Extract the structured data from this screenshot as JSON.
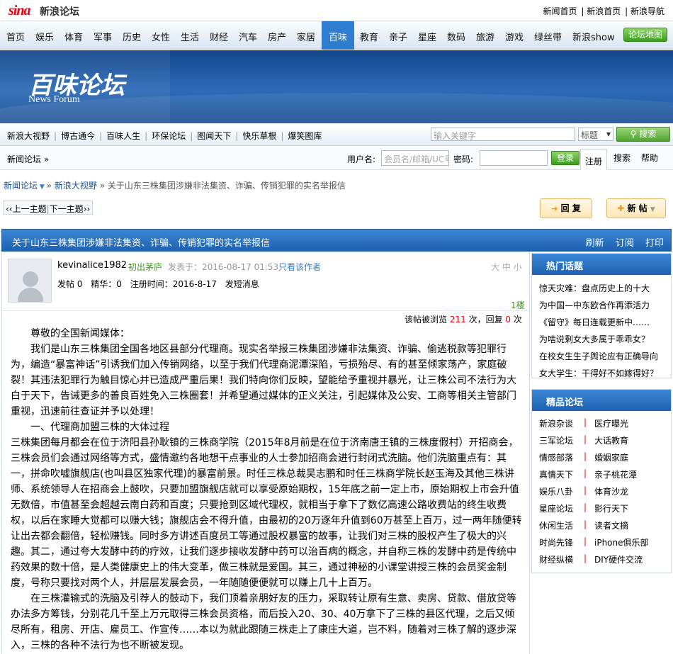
{
  "topbar": {
    "logo": "sina",
    "logo_text": "新浪论坛",
    "links": [
      "新闻首页",
      "新浪首页",
      "新浪导航"
    ],
    "sep": "|"
  },
  "nav": {
    "items": [
      "首页",
      "娱乐",
      "体育",
      "军事",
      "历史",
      "女性",
      "生活",
      "财经",
      "汽车",
      "房产",
      "家居",
      "百味",
      "教育",
      "亲子",
      "星座",
      "数码",
      "旅游",
      "游戏",
      "绿丝带",
      "新浪show"
    ],
    "active": "百味",
    "map_button": "论坛地图"
  },
  "banner": {
    "title": "百味论坛",
    "subtitle": "News Forum"
  },
  "subnav": {
    "links": [
      "新浪大视野",
      "博古通今",
      "百味人生",
      "环保论坛",
      "图闻天下",
      "快乐草根",
      "爆笑图库"
    ],
    "sep": "|",
    "search_placeholder": "输入关键字",
    "search_select": "标题",
    "search_button": "搜索"
  },
  "loginbar": {
    "crumb": "新闻论坛 »",
    "username_label": "用户名:",
    "username_placeholder": "会员名/邮箱/UC号",
    "password_label": "密码:",
    "login_button": "登录",
    "register": "注册",
    "search": "搜索",
    "help": "帮助"
  },
  "breadcrumb": {
    "forum": "新闻论坛",
    "board": "新浪大视野",
    "title": "关于山东三株集团涉嫌非法集资、诈骗、传销犯罪的实名举报信",
    "sep": "»"
  },
  "pager": {
    "prev": "上一主题",
    "next": "下一主题"
  },
  "buttons": {
    "reply": "回 复",
    "post": "新 帖"
  },
  "thread": {
    "title": "关于山东三株集团涉嫌非法集资、诈骗、传销犯罪的实名举报信",
    "actions": [
      "刷新",
      "订阅",
      "打印"
    ]
  },
  "post": {
    "username": "kevinalice1982",
    "rank": "初出茅庐",
    "posted": "发表于：2016-08-17 01:53",
    "only_author": "只看该作者",
    "font_size": "大 中 小",
    "stats": [
      "发帖 0",
      "精华：0",
      "注册时间：2016-8-17",
      "发短消息"
    ],
    "floor": "1楼",
    "views_label": "该帖被浏览",
    "views": "211",
    "times": "次，回复",
    "replies": "0",
    "times2": "次",
    "paragraphs": [
      "尊敬的全国新闻媒体：",
      "我们是山东三株集团全国各地区县部分代理商。现实名举报三株集团涉嫌非法集资、诈骗、偷逃税款等犯罪行为，编造“暴富神话”引诱我们加入传销网络，以至于我们代理商泥潭深陷，亏损殆尽、有的甚至倾家荡产，家庭破裂！其违法犯罪行为触目惊心并已造成严重后果！我们特向你们反映，望能给予重视并暴光，让三株公司不法行为大白于天下，告诫更多的善良百姓免入三株圈套！并希望通过媒体的正义关注，引起媒体及公安、工商等相关主管部门重视，迅速前往查证并予以处理！",
      "一、代理商加盟三株的大体过程",
      "三株集团每月都会在位于济阳县孙耿镇的三株商学院（2015年8月前是在位于济南唐王镇的三株度假村）开招商会，三株会员们会通过网络等方式，盛情邀约各地想干点事业的人士参加招商会进行封闭式洗脑。他们洗脑重点有：其一，拼命吹嘘旗舰店(也叫县区独家代理)的暴富前景。时任三株总裁吴志鹏和时任三株商学院长赵玉海及其他三株讲师、系统领导人在招商会上鼓吹，只要加盟旗舰店就可以享受原始期权，15年底之前一定上市，原始期权上市会升值无数倍，市值甚至会超越云南白药和百度；只要抢到区域代理权，就相当于拿下了数亿高速公路收费站的终生收费权，以后在家睡大觉都可以赚大钱；旗舰店会不得升值，由最初的20万逐年升值到60万甚至上百万，过一两年随便转让出去都会翻倍，轻松赚钱。同时多方讲述百度员工等通过股权暴富的故事，让我们对三株的股权产生了极大的兴趣。其二，通过夸大发酵中药的疗效，让我们逐步接收发酵中药可以治百病的概念，并自称三株的发酵中药是传统中药效果的数十倍，是人类健康史上的伟大变革，做三株就是爱国。其三，通过神秘的小课堂讲授三株的会员奖金制度，号称只要找对两个人，并层层发展会员，一年随随便便就可以赚上几十上百万。",
      "在三株灌输式的洗脑及引荐人的鼓动下，我们顶着亲朋好友的压力，采取转让原有生意、卖房、贷款、借放贷等办法多方筹钱，分别花几千至上万元取得三株会员资格，而后投入20、30、40万拿下了三株的县区代理，之后又倾尽所有，租房、开店、雇员工、作宣传……本以为就此跟随三株走上了康庄大道，岂不料，随着对三株了解的逐步深入，三株的各种不法行为也不断被发现。"
    ]
  },
  "sidebar": {
    "hot_title": "热门话题",
    "hot": [
      "惊天灾难：盘点历史上的十大",
      "为中国—中东欧合作再添活力",
      "《留守》每日连载更新中……",
      "为啥说剩女大多属于乖乖女？",
      "在校女生生子舆论应有正确导向",
      "女大学生：干得好不如嫁得好？"
    ],
    "best_title": "精品论坛",
    "best": [
      [
        "新浪杂谈",
        "医疗曝光"
      ],
      [
        "三军论坛",
        "大话教育"
      ],
      [
        "情感部落",
        "婚姻家庭"
      ],
      [
        "真情天下",
        "亲子桃花潭"
      ],
      [
        "娱乐八卦",
        "体育沙龙"
      ],
      [
        "星座论坛",
        "影行天下"
      ],
      [
        "休闲生活",
        "读者文摘"
      ],
      [
        "时尚先锋",
        "iPhone俱乐部"
      ],
      [
        "财经纵横",
        "DIY硬件交流"
      ]
    ],
    "best_sep": "|"
  }
}
